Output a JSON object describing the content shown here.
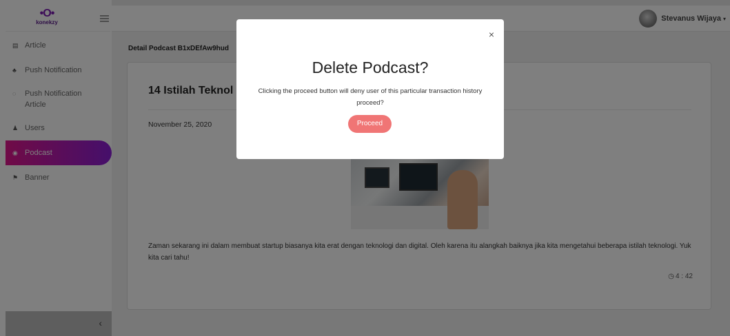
{
  "app": {
    "logo_text": "konekzy",
    "logo_mark": "•O•"
  },
  "sidebar": {
    "items": [
      {
        "label": "Article",
        "icon": "newspaper-icon",
        "glyph": "▤"
      },
      {
        "label": "Push Notification",
        "icon": "bell-icon",
        "glyph": "♣"
      },
      {
        "label": "Push Notification Article",
        "icon": "circle-notch-icon",
        "glyph": "◌"
      },
      {
        "label": "Users",
        "icon": "user-icon",
        "glyph": "♟"
      },
      {
        "label": "Podcast",
        "icon": "podcast-icon",
        "glyph": "◉",
        "active": true
      },
      {
        "label": "Banner",
        "icon": "flag-icon",
        "glyph": "⚑"
      }
    ],
    "collapse_glyph": "‹"
  },
  "topbar": {
    "user_name": "Stevanus Wijaya",
    "caret": "▾"
  },
  "main": {
    "breadcrumb": "Detail Podcast B1xDEfAw9hud",
    "post": {
      "title": "14 Istilah Teknol",
      "date": "November 25, 2020",
      "body": "Zaman sekarang ini dalam membuat startup biasanya kita erat dengan teknologi dan digital. Oleh karena itu alangkah baiknya jika kita mengetahui beberapa istilah teknologi. Yuk kita cari tahu!",
      "duration": "4 : 42",
      "clock_glyph": "◷"
    }
  },
  "modal": {
    "close_glyph": "×",
    "title": "Delete Podcast?",
    "text": "Clicking the proceed button will deny user of this particular transaction history proceed?",
    "proceed_label": "Proceed"
  },
  "colors": {
    "active_gradient_start": "#e0168d",
    "active_gradient_end": "#8b1fd6",
    "proceed_button": "#f07575",
    "brand": "#7a1bb0"
  }
}
